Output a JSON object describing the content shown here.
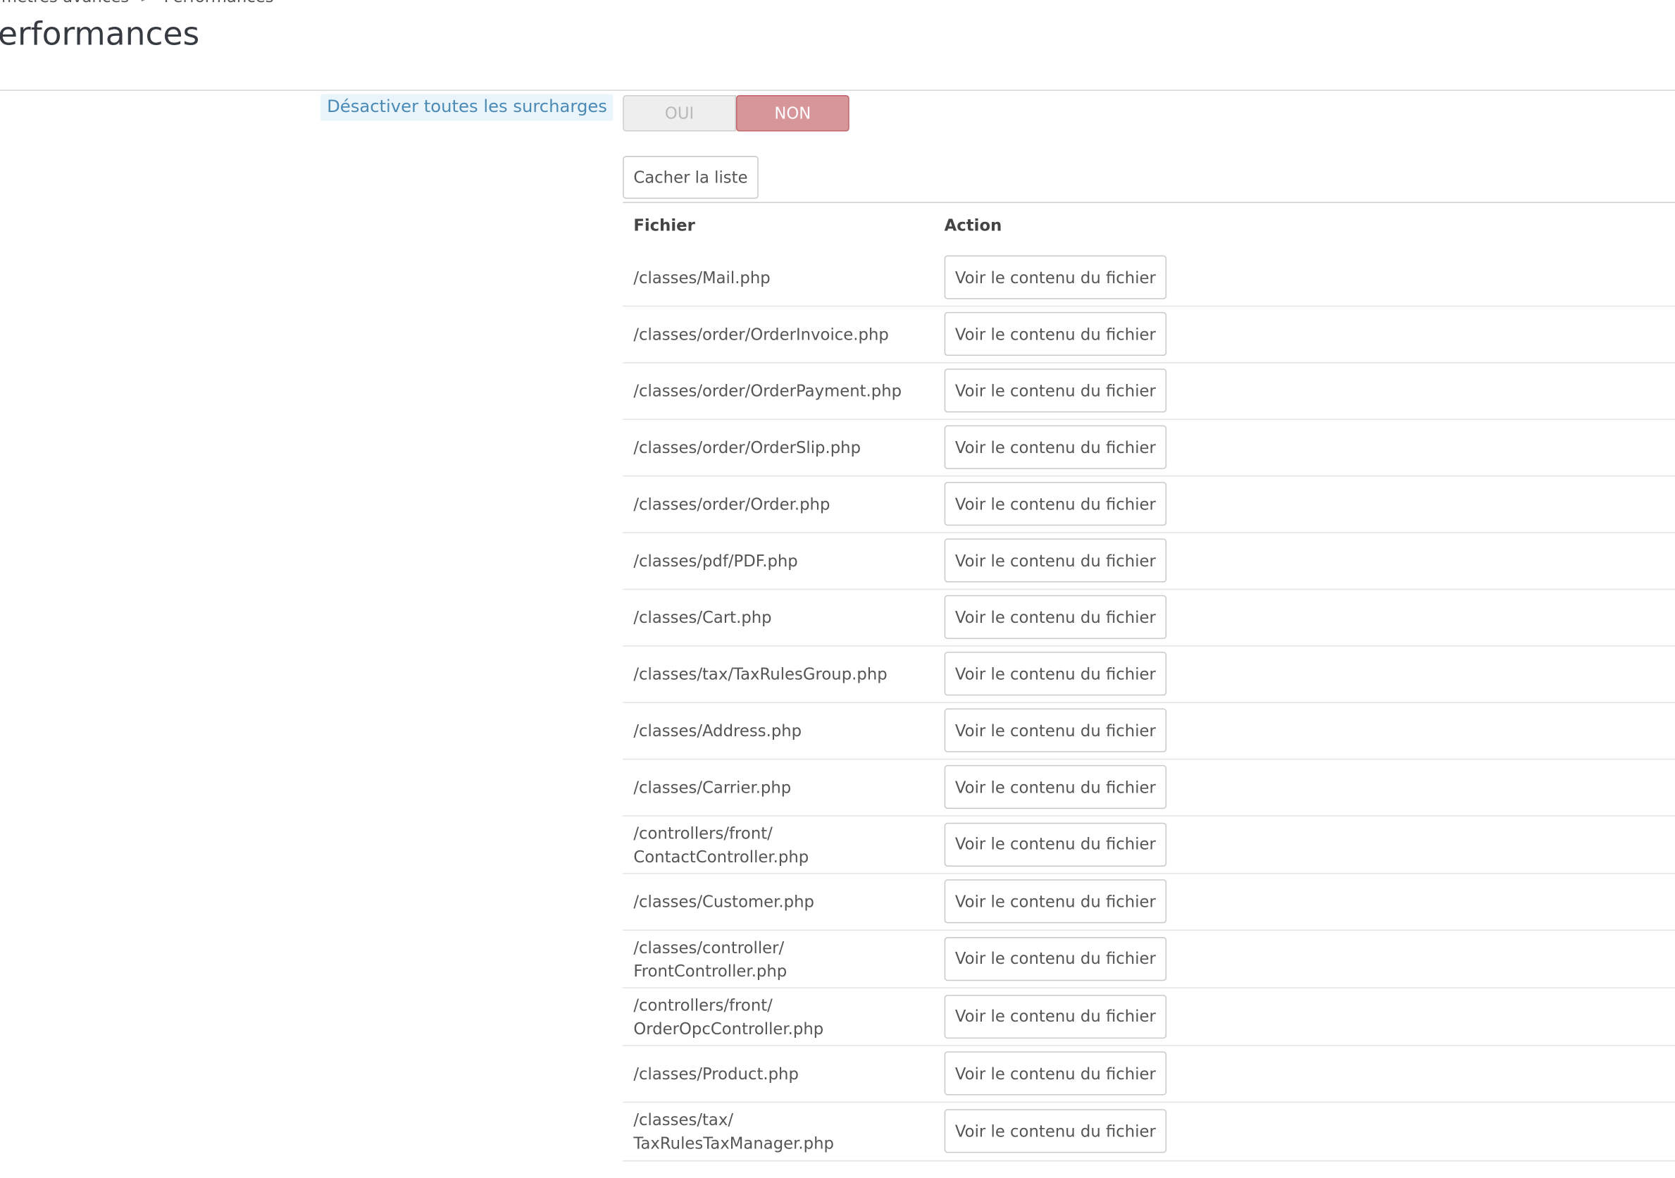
{
  "breadcrumb": {
    "parent": "ramètres avancés",
    "separator": ">",
    "current": "Performances"
  },
  "page_title": "erformances",
  "overrides": {
    "label": "Désactiver toutes les surcharges",
    "switch": {
      "yes_label": "OUI",
      "no_label": "NON",
      "selected": "NON"
    }
  },
  "list": {
    "toggle_button": "Cacher la liste",
    "columns": {
      "file": "Fichier",
      "action": "Action"
    },
    "action_label": "Voir le contenu du fichier",
    "rows": [
      "/classes/Mail.php",
      "/classes/order/OrderInvoice.php",
      "/classes/order/OrderPayment.php",
      "/classes/order/OrderSlip.php",
      "/classes/order/Order.php",
      "/classes/pdf/PDF.php",
      "/classes/Cart.php",
      "/classes/tax/TaxRulesGroup.php",
      "/classes/Address.php",
      "/classes/Carrier.php",
      "/controllers/front/ ContactController.php",
      "/classes/Customer.php",
      "/classes/controller/ FrontController.php",
      "/controllers/front/ OrderOpcController.php",
      "/classes/Product.php",
      "/classes/tax/ TaxRulesTaxManager.php"
    ]
  },
  "colors": {
    "accent_label_bg": "#eaf4fb",
    "accent_label_text": "#4b8ab5",
    "switch_no_bg": "#d7969a"
  }
}
